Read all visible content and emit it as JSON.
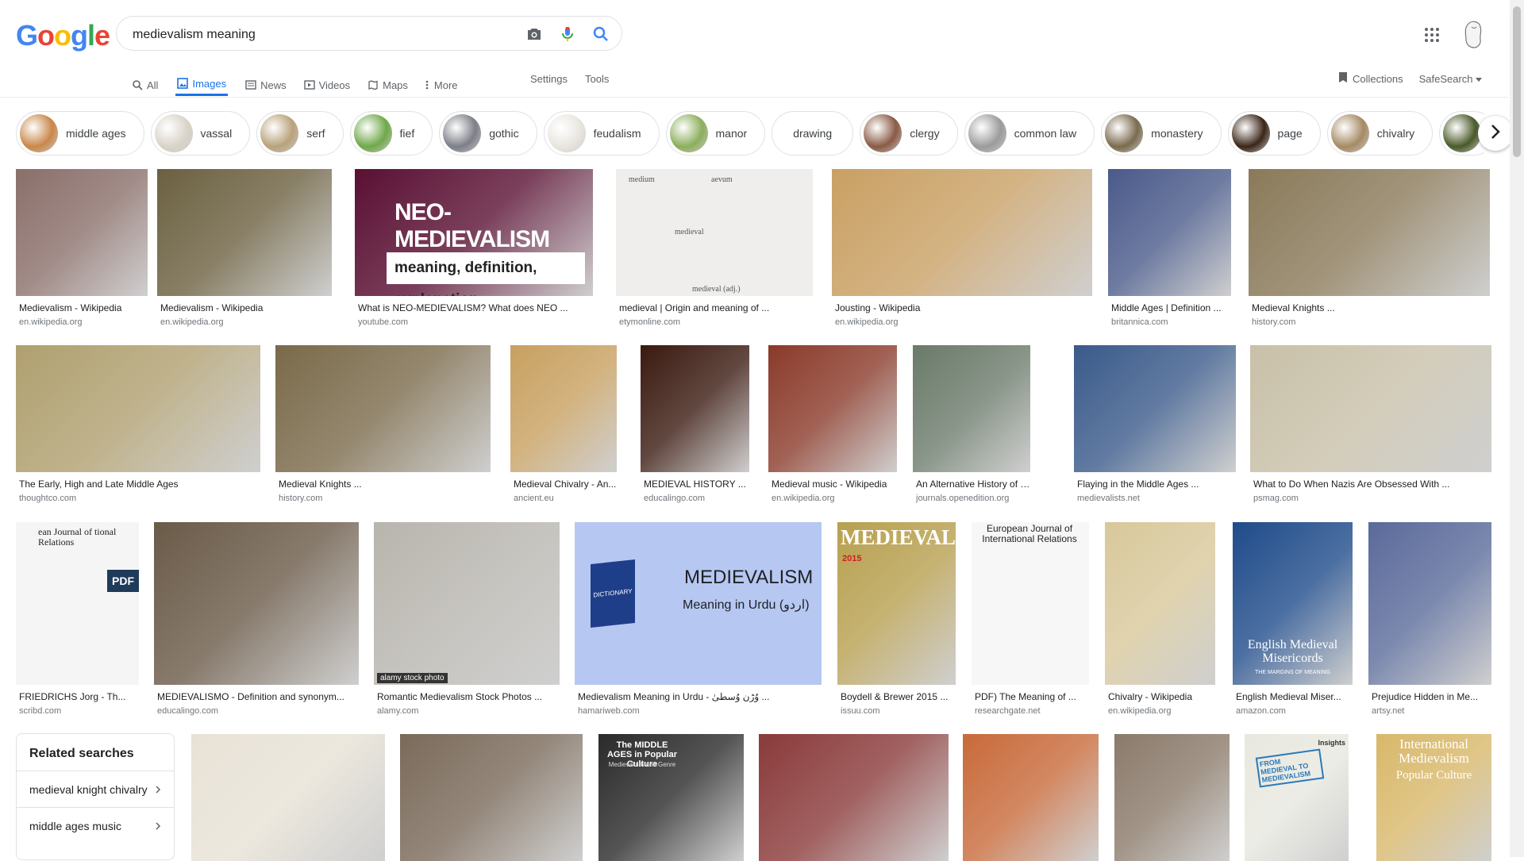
{
  "logo": {
    "letters": [
      "G",
      "o",
      "o",
      "g",
      "l",
      "e"
    ],
    "colors": [
      "#4285f4",
      "#ea4335",
      "#fbbc05",
      "#4285f4",
      "#34a853",
      "#ea4335"
    ]
  },
  "search": {
    "query": "medievalism meaning"
  },
  "tabs": [
    {
      "label": "All",
      "icon": "search-icon"
    },
    {
      "label": "Images",
      "icon": "image-icon",
      "active": true
    },
    {
      "label": "News",
      "icon": "news-icon"
    },
    {
      "label": "Videos",
      "icon": "video-icon"
    },
    {
      "label": "Maps",
      "icon": "map-icon"
    },
    {
      "label": "More",
      "icon": "more-vert-icon"
    }
  ],
  "tools": {
    "settings": "Settings",
    "tools": "Tools"
  },
  "right": {
    "collections": "Collections",
    "safesearch": "SafeSearch"
  },
  "chips": [
    {
      "label": "middle ages",
      "color": "#c9874a"
    },
    {
      "label": "vassal",
      "color": "#d9d4c8"
    },
    {
      "label": "serf",
      "color": "#b8a27a"
    },
    {
      "label": "fief",
      "color": "#6fa84a"
    },
    {
      "label": "gothic",
      "color": "#7d7f88"
    },
    {
      "label": "feudalism",
      "color": "#e9e6df"
    },
    {
      "label": "manor",
      "color": "#8cae5c"
    },
    {
      "label": "drawing",
      "color": ""
    },
    {
      "label": "clergy",
      "color": "#8a5a45"
    },
    {
      "label": "common law",
      "color": "#9b9b9b"
    },
    {
      "label": "monastery",
      "color": "#7a6b4e"
    },
    {
      "label": "page",
      "color": "#3b2618"
    },
    {
      "label": "chivalry",
      "color": "#a58a64"
    },
    {
      "label": "",
      "color": "#4a5a2a"
    }
  ],
  "results": [
    {
      "caption": "Medievalism - Wikipedia",
      "source": "en.wikipedia.org",
      "color": "#8a6f6a"
    },
    {
      "caption": "Medievalism - Wikipedia",
      "source": "en.wikipedia.org",
      "color": "#6b6040"
    },
    {
      "caption": "What is NEO-MEDIEVALISM? What does NEO ...",
      "source": "youtube.com",
      "color": "#5a1033",
      "title": "NEO-MEDIEVALISM",
      "subtitle": "meaning, definition, explanation"
    },
    {
      "caption": "medieval | Origin and meaning of ...",
      "source": "etymonline.com",
      "color": "#efeeec",
      "words": [
        "medium",
        "aevum",
        "medieval",
        "medieval (adj.)"
      ]
    },
    {
      "caption": "Jousting - Wikipedia",
      "source": "en.wikipedia.org",
      "color": "#c9a064"
    },
    {
      "caption": "Middle Ages | Definition ...",
      "source": "britannica.com",
      "color": "#4a5a8a"
    },
    {
      "caption": "Medieval Knights ...",
      "source": "history.com",
      "color": "#8a7a5a"
    },
    {
      "caption": "The Early, High and Late Middle Ages",
      "source": "thoughtco.com",
      "color": "#b0a070"
    },
    {
      "caption": "Medieval Knights ...",
      "source": "history.com",
      "color": "#7a6a4a"
    },
    {
      "caption": "Medieval Chivalry - An...",
      "source": "ancient.eu",
      "color": "#c8a060"
    },
    {
      "caption": "MEDIEVAL HISTORY ...",
      "source": "educalingo.com",
      "color": "#3a1a10"
    },
    {
      "caption": "Medieval music - Wikipedia",
      "source": "en.wikipedia.org",
      "color": "#8a3a2a"
    },
    {
      "caption": "An Alternative History of the ...",
      "source": "journals.openedition.org",
      "color": "#6a7a6a"
    },
    {
      "caption": "Flaying in the Middle Ages ...",
      "source": "medievalists.net",
      "color": "#3a5a8a"
    },
    {
      "caption": "What to Do When Nazis Are Obsessed With ...",
      "source": "psmag.com",
      "color": "#c8c0a8"
    },
    {
      "caption": "FRIEDRICHS Jorg - Th...",
      "source": "scribd.com",
      "color": "#f5f5f5",
      "badge": "PDF",
      "header": "ean Journal of tional Relations"
    },
    {
      "caption": "MEDIEVALISMO - Definition and synonym...",
      "source": "educalingo.com",
      "color": "#6a5a48"
    },
    {
      "caption": "Romantic Medievalism Stock Photos ...",
      "source": "alamy.com",
      "color": "#b8b5ae",
      "watermark": "alamy stock photo"
    },
    {
      "caption": "Medievalism Meaning in Urdu - وُڑن وُسطیٰ ...",
      "source": "hamariweb.com",
      "color": "#b6c8f2",
      "title": "MEDIEVALISM",
      "subtitle": "Meaning in Urdu (اردو)",
      "book": "DICTIONARY"
    },
    {
      "caption": "Boydell & Brewer 2015 ...",
      "source": "issuu.com",
      "color": "#b8a050",
      "title": "MEDIEVAL",
      "year": "2015"
    },
    {
      "caption": "PDF) The Meaning of ...",
      "source": "researchgate.net",
      "color": "#f7f7f7",
      "header": "European Journal of International Relations"
    },
    {
      "caption": "Chivalry - Wikipedia",
      "source": "en.wikipedia.org",
      "color": "#d8c89a"
    },
    {
      "caption": "English Medieval Miser...",
      "source": "amazon.com",
      "color": "#1f4b8a",
      "title": "English Medieval Misericords",
      "subtitle": "THE MARGINS OF MEANING"
    },
    {
      "caption": "Prejudice Hidden in Me...",
      "source": "artsy.net",
      "color": "#5a6a9a"
    },
    {
      "color": "#e8e2d6"
    },
    {
      "color": "#7a6a5a"
    },
    {
      "color": "#2a2a2a",
      "title": "The MIDDLE AGES in Popular Culture",
      "subtitle": "Medievalism and Genre"
    },
    {
      "color": "#8a3a3a"
    },
    {
      "color": "#c86a3a"
    },
    {
      "color": "#8a7a6a"
    },
    {
      "color": "#e8e8e0",
      "title": "FROM MEDIEVAL TO MEDIEVALISM",
      "badge": "Insights"
    },
    {
      "color": "#d8b86a",
      "title": "International Medievalism",
      "subtitle": "Popular Culture"
    }
  ],
  "related": {
    "title": "Related searches",
    "items": [
      "medieval knight chivalry",
      "middle ages music"
    ]
  }
}
